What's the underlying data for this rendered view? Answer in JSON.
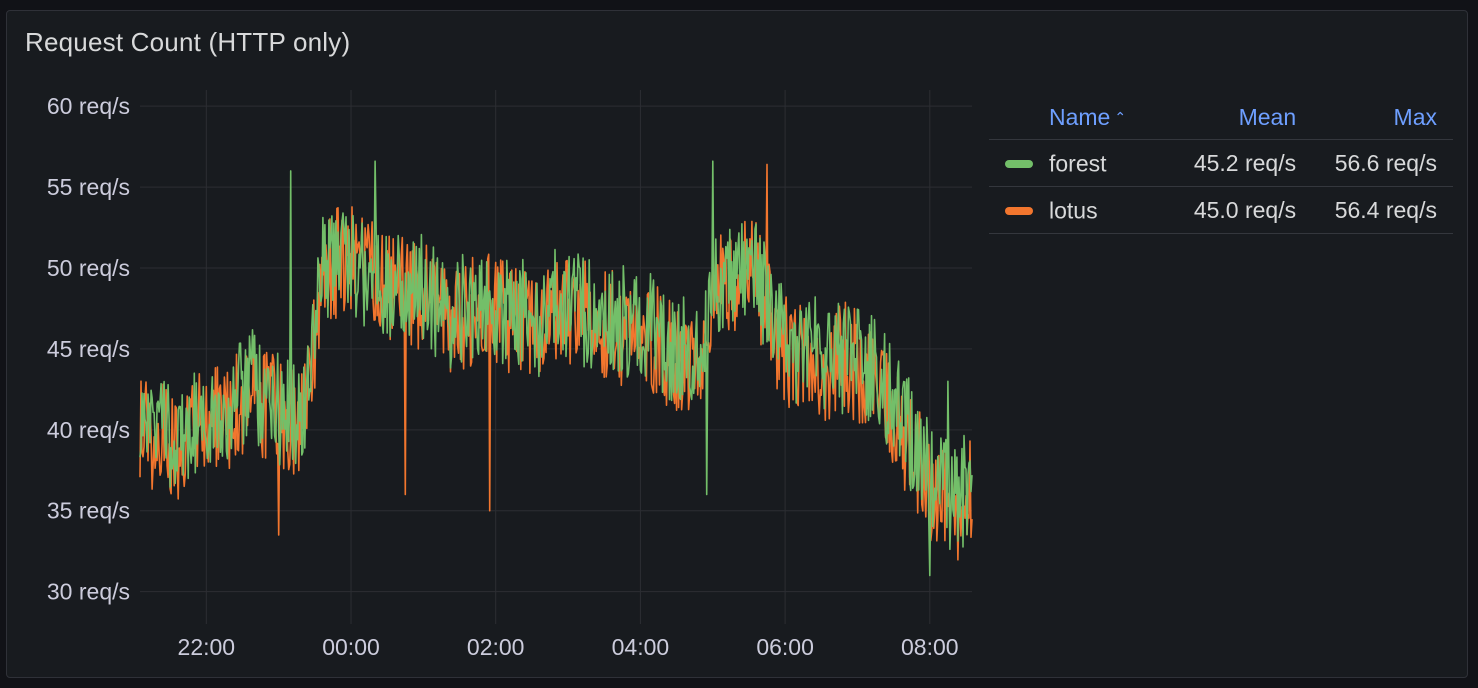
{
  "panel": {
    "title": "Request Count (HTTP only)"
  },
  "legend": {
    "headers": {
      "name": "Name",
      "mean": "Mean",
      "max": "Max"
    },
    "sort_icon": "chevron-up-icon",
    "rows": [
      {
        "name": "forest",
        "color": "#73bf69",
        "mean": "45.2 req/s",
        "max": "56.6 req/s"
      },
      {
        "name": "lotus",
        "color": "#f2762e",
        "mean": "45.0 req/s",
        "max": "56.4 req/s"
      }
    ]
  },
  "chart_data": {
    "type": "line",
    "title": "Request Count (HTTP only)",
    "xlabel": "",
    "ylabel": "",
    "unit": "req/s",
    "ylim": [
      28,
      61
    ],
    "yticks": [
      60,
      55,
      50,
      45,
      40,
      35,
      30
    ],
    "ytick_labels": [
      "60 req/s",
      "55 req/s",
      "50 req/s",
      "45 req/s",
      "40 req/s",
      "35 req/s",
      "30 req/s"
    ],
    "xlim": [
      "21:05",
      "08:35"
    ],
    "xticks": [
      "22:00",
      "00:00",
      "02:00",
      "04:00",
      "06:00",
      "08:00"
    ],
    "grid": true,
    "legend_placement": "right",
    "x": [
      "21:05",
      "21:20",
      "21:35",
      "21:50",
      "22:05",
      "22:20",
      "22:35",
      "22:50",
      "23:05",
      "23:20",
      "23:35",
      "23:50",
      "00:05",
      "00:20",
      "00:35",
      "00:50",
      "01:05",
      "01:20",
      "01:35",
      "01:50",
      "02:05",
      "02:20",
      "02:35",
      "02:50",
      "03:05",
      "03:20",
      "03:35",
      "03:50",
      "04:05",
      "04:20",
      "04:35",
      "04:50",
      "05:05",
      "05:20",
      "05:35",
      "05:50",
      "06:05",
      "06:20",
      "06:35",
      "06:50",
      "07:05",
      "07:20",
      "07:35",
      "07:50",
      "08:05",
      "08:20",
      "08:35"
    ],
    "series": [
      {
        "name": "forest",
        "color": "#73bf69",
        "values": [
          41.5,
          40.0,
          39.5,
          40.5,
          40.0,
          41.5,
          43.0,
          42.0,
          41.0,
          40.5,
          49.5,
          51.0,
          50.0,
          49.5,
          49.0,
          49.0,
          48.5,
          47.0,
          47.5,
          48.0,
          47.0,
          47.5,
          46.5,
          48.0,
          47.5,
          47.0,
          47.0,
          46.5,
          46.5,
          45.5,
          45.0,
          45.0,
          49.5,
          49.5,
          50.0,
          46.5,
          45.0,
          45.0,
          44.5,
          44.5,
          44.0,
          43.0,
          41.0,
          38.5,
          36.5,
          35.5,
          37.0
        ]
      },
      {
        "name": "lotus",
        "color": "#f2762e",
        "values": [
          40.5,
          39.5,
          39.0,
          40.0,
          40.5,
          41.0,
          42.5,
          41.5,
          40.5,
          40.0,
          49.0,
          50.5,
          50.5,
          49.5,
          48.5,
          48.5,
          48.0,
          47.0,
          47.0,
          47.5,
          47.0,
          47.0,
          46.5,
          47.5,
          47.0,
          47.0,
          46.5,
          46.0,
          46.0,
          45.0,
          44.5,
          45.0,
          49.0,
          49.5,
          49.5,
          46.0,
          44.5,
          44.5,
          44.0,
          44.5,
          43.5,
          42.5,
          40.0,
          38.0,
          35.5,
          35.0,
          36.5
        ]
      }
    ],
    "annotations": [
      {
        "x": "23:00",
        "series": "lotus",
        "value": 33.5
      },
      {
        "x": "23:10",
        "series": "forest",
        "value": 56.0
      },
      {
        "x": "00:20",
        "series": "forest",
        "value": 56.6
      },
      {
        "x": "00:45",
        "series": "lotus",
        "value": 36.0
      },
      {
        "x": "01:55",
        "series": "lotus",
        "value": 35.0
      },
      {
        "x": "04:55",
        "series": "forest",
        "value": 36.0
      },
      {
        "x": "05:00",
        "series": "forest",
        "value": 56.6
      },
      {
        "x": "05:45",
        "series": "lotus",
        "value": 56.4
      },
      {
        "x": "08:00",
        "series": "forest",
        "value": 31.0
      },
      {
        "x": "08:15",
        "series": "forest",
        "value": 43.0
      }
    ]
  }
}
